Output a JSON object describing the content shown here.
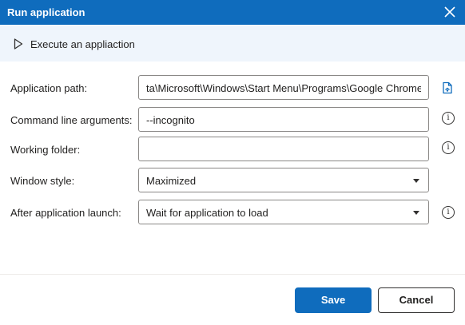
{
  "dialog": {
    "title": "Run application"
  },
  "header": {
    "description": "Execute an appliaction"
  },
  "form": {
    "application_path": {
      "label": "Application path:",
      "value": "ta\\Microsoft\\Windows\\Start Menu\\Programs\\Google Chrome.lnk\""
    },
    "command_line_arguments": {
      "label": "Command line arguments:",
      "value": "--incognito"
    },
    "working_folder": {
      "label": "Working folder:",
      "value": ""
    },
    "window_style": {
      "label": "Window style:",
      "value": "Maximized"
    },
    "after_application_launch": {
      "label": "After application launch:",
      "value": "Wait for application to load"
    }
  },
  "buttons": {
    "save": "Save",
    "cancel": "Cancel"
  },
  "icons": {
    "close": "close-icon",
    "play": "play-icon",
    "file": "file-select-icon",
    "info": "info-icon",
    "info_glyph": "i"
  },
  "colors": {
    "accent": "#0f6cbd",
    "header_bg": "#eff5fc",
    "border": "#8a8886"
  }
}
